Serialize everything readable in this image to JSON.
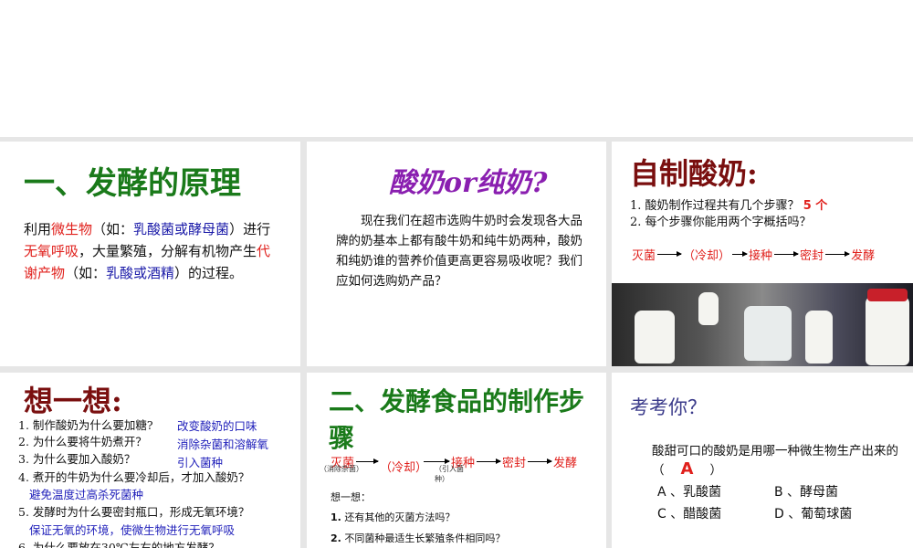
{
  "p1": {
    "title": "一、发酵的原理",
    "parts": [
      "利用",
      "微生物",
      "（如：",
      "乳酸菌或酵母菌",
      "）进行",
      "无氧呼吸",
      "，大量繁殖，分解有机物产生",
      "代谢产物",
      "（如：",
      "乳酸或酒精",
      "）的过程。"
    ]
  },
  "p2": {
    "title": "酸奶or纯奶?",
    "body": "现在我们在超市选购牛奶时会发现各大品牌的奶基本上都有酸牛奶和纯牛奶两种，酸奶和纯奶谁的营养价值更高更容易吸收呢？我们应如何选购奶产品？"
  },
  "p3": {
    "title": "自制酸奶:",
    "q1": "1. 酸奶制作过程共有几个步骤？",
    "a1": "5 个",
    "q2": "2. 每个步骤你能用两个字概括吗？",
    "flow": [
      "灭菌",
      "（冷却）",
      "接种",
      "密封",
      "发酵"
    ]
  },
  "p4": {
    "title": "想一想:",
    "items": [
      {
        "q": "1. 制作酸奶为什么要加糖?",
        "a": "改变酸奶的口味"
      },
      {
        "q": "2. 为什么要将牛奶煮开？",
        "a": "消除杂菌和溶解氧"
      },
      {
        "q": "3. 为什么要加入酸奶？",
        "a": "引入菌种"
      },
      {
        "q": "4. 煮开的牛奶为什么要冷却后，才加入酸奶？",
        "a": "避免温度过高杀死菌种"
      },
      {
        "q": "5. 发酵时为什么要密封瓶口，形成无氧环境？",
        "a": "保证无氧的环境，使微生物进行无氧呼吸"
      },
      {
        "q": "6. 为什么要放在30℃左右的地方发酵？"
      }
    ]
  },
  "p5": {
    "title": "二、发酵食品的制作步骤",
    "flow": [
      "灭菌",
      "（冷却）",
      "接种",
      "密封",
      "发酵"
    ],
    "note1": "（消除杂菌）",
    "note2": "（引入菌种）",
    "think": "想一想：",
    "q1n": "1.",
    "q1": "还有其他的灭菌方法吗？",
    "q2n": "2.",
    "q2": "不同菌种最适生长繁殖条件相同吗？"
  },
  "p6": {
    "title": "考考你？",
    "question": "酸甜可口的酸奶是用哪一种微生物生产出来的（",
    "close": "）",
    "answer": "A",
    "options": [
      "A 、乳酸菌",
      "B 、酵母菌",
      "C 、醋酸菌",
      "D 、葡萄球菌"
    ]
  }
}
